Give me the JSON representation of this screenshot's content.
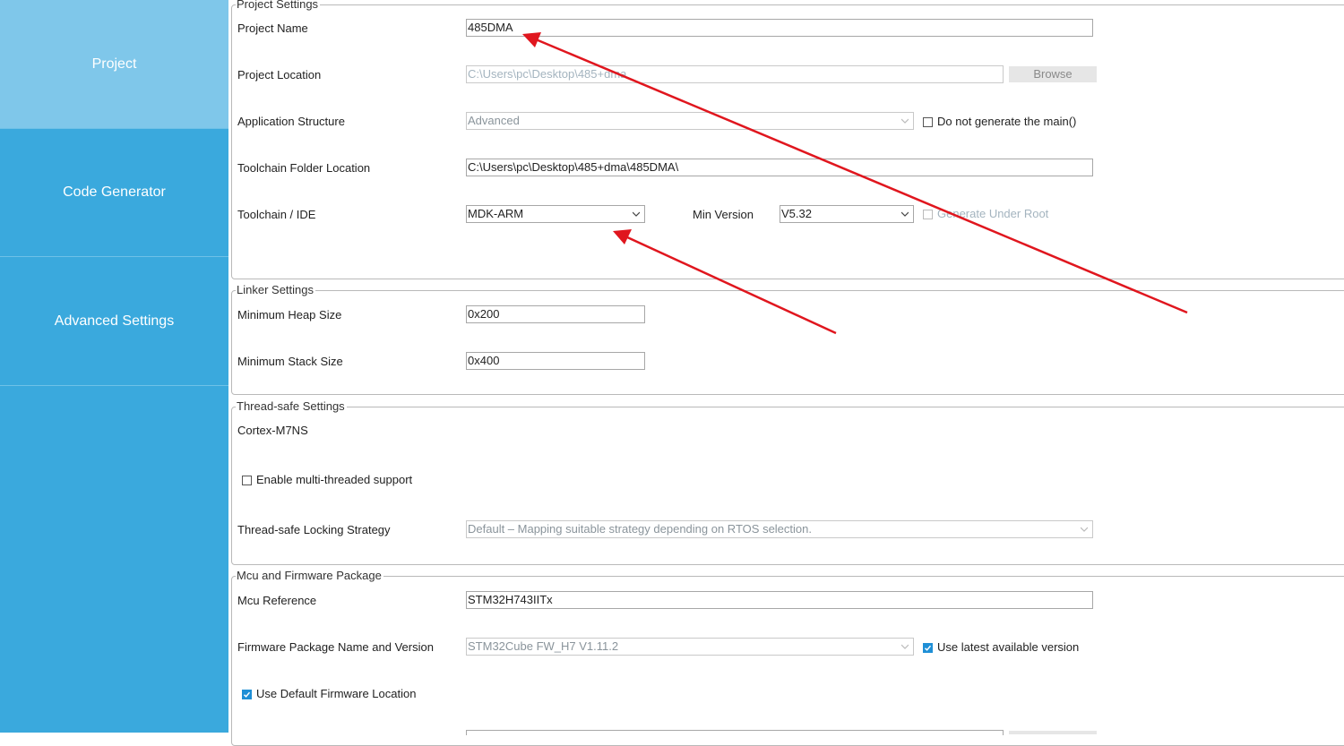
{
  "sidebar": {
    "items": [
      {
        "label": "Project",
        "active": true
      },
      {
        "label": "Code Generator",
        "active": false
      },
      {
        "label": "Advanced Settings",
        "active": false
      }
    ]
  },
  "project_settings": {
    "legend": "Project Settings",
    "project_name": {
      "label": "Project Name",
      "value": "485DMA"
    },
    "project_location": {
      "label": "Project Location",
      "value": "C:\\Users\\pc\\Desktop\\485+dma",
      "browse": "Browse"
    },
    "application_structure": {
      "label": "Application Structure",
      "value": "Advanced",
      "no_main_label": "Do not generate the main()"
    },
    "toolchain_folder": {
      "label": "Toolchain Folder Location",
      "value": "C:\\Users\\pc\\Desktop\\485+dma\\485DMA\\"
    },
    "toolchain_ide": {
      "label": "Toolchain / IDE",
      "value": "MDK-ARM",
      "min_version_label": "Min Version",
      "min_version": "V5.32",
      "generate_under_root": "Generate Under Root"
    }
  },
  "linker_settings": {
    "legend": "Linker Settings",
    "heap": {
      "label": "Minimum Heap Size",
      "value": "0x200"
    },
    "stack": {
      "label": "Minimum Stack Size",
      "value": "0x400"
    }
  },
  "thread_safe": {
    "legend": "Thread-safe Settings",
    "core": "Cortex-M7NS",
    "enable_label": "Enable multi-threaded support",
    "strategy_label": "Thread-safe Locking Strategy",
    "strategy_value": "Default  –  Mapping suitable strategy depending on RTOS selection."
  },
  "mcu_firmware": {
    "legend": "Mcu and Firmware Package",
    "mcu_ref": {
      "label": "Mcu Reference",
      "value": "STM32H743IITx"
    },
    "firmware": {
      "label": "Firmware Package Name and Version",
      "value": "STM32Cube FW_H7 V1.11.2",
      "latest_label": "Use latest available version"
    },
    "default_location_label": "Use Default Firmware Location"
  },
  "colors": {
    "sidebar": "#3aa9dd",
    "sidebar_active": "#7fc7ea",
    "annotation_arrow": "#e0161e",
    "checkbox_checked": "#1f8fd6"
  }
}
